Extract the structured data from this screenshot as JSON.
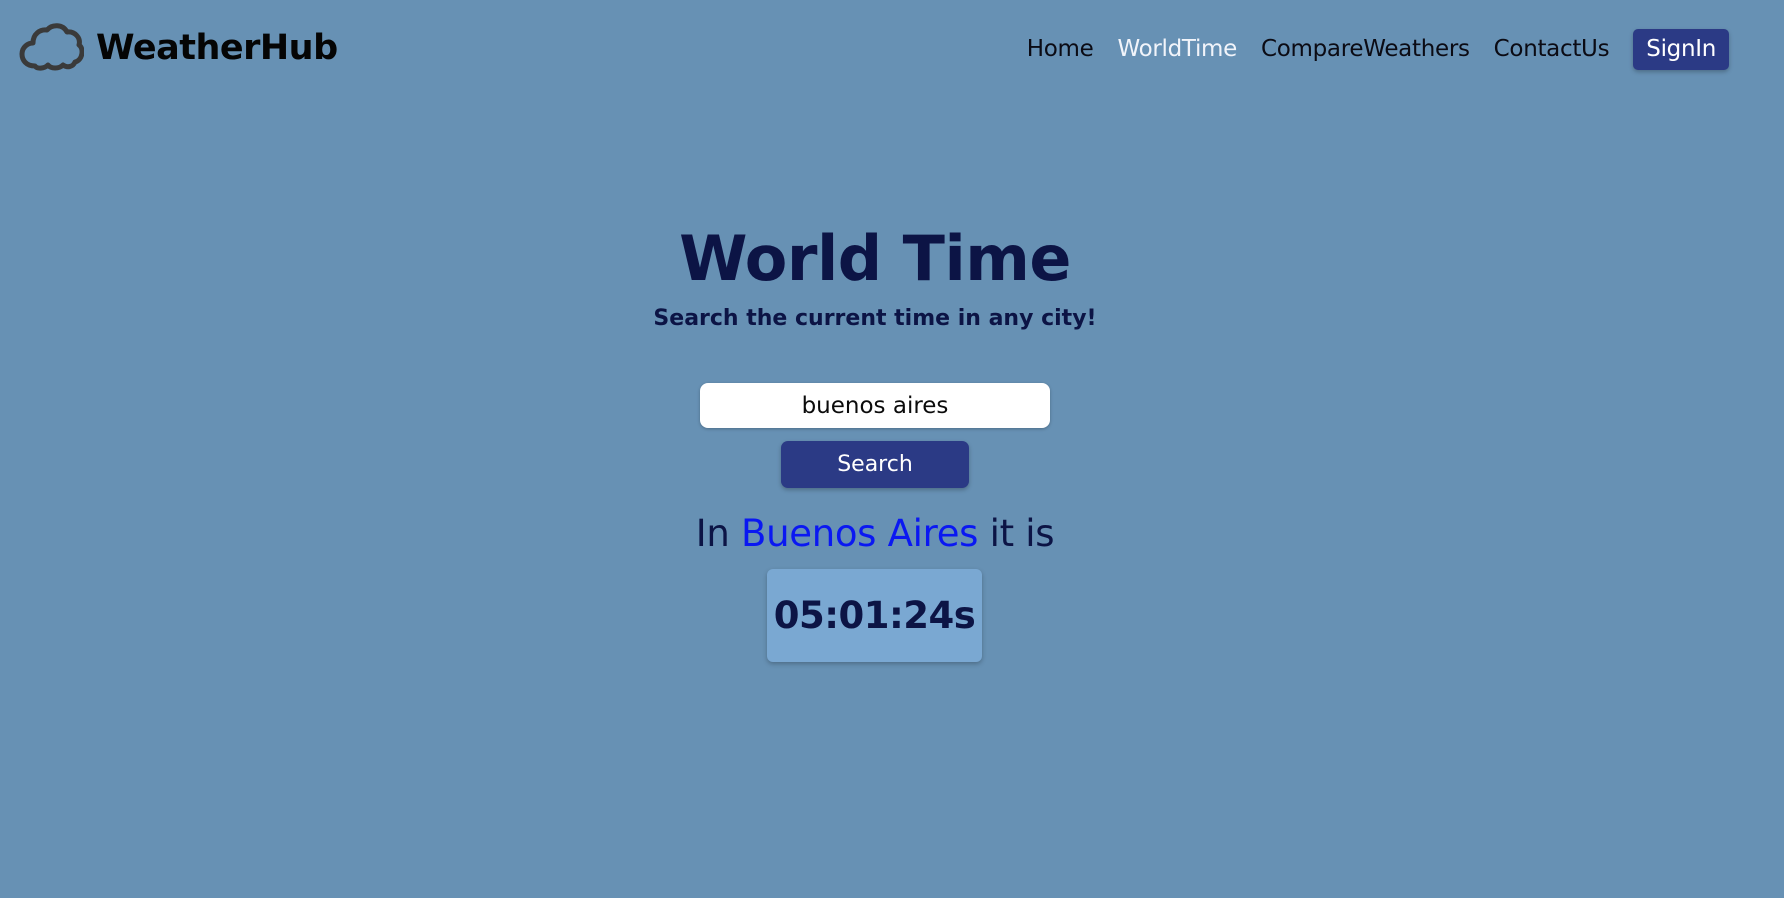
{
  "header": {
    "brand_name": "WeatherHub",
    "logo_icon": "cloud-icon",
    "nav": [
      {
        "label": "Home",
        "active": false
      },
      {
        "label": "WorldTime",
        "active": true
      },
      {
        "label": "CompareWeathers",
        "active": false
      },
      {
        "label": "ContactUs",
        "active": false
      }
    ],
    "signin_label": "SignIn"
  },
  "main": {
    "title": "World Time",
    "subtitle": "Search the current time in any city!",
    "search": {
      "value": "buenos aires",
      "placeholder": "",
      "button_label": "Search"
    },
    "result": {
      "prefix": "In",
      "city": "Buenos Aires",
      "suffix": "it is",
      "time": "05:01:24s"
    }
  },
  "colors": {
    "background": "#6791b4",
    "accent": "#2b3a85",
    "city_highlight": "#0a18f2",
    "time_box": "#7aa8d2",
    "text_dark": "#0c1445"
  }
}
